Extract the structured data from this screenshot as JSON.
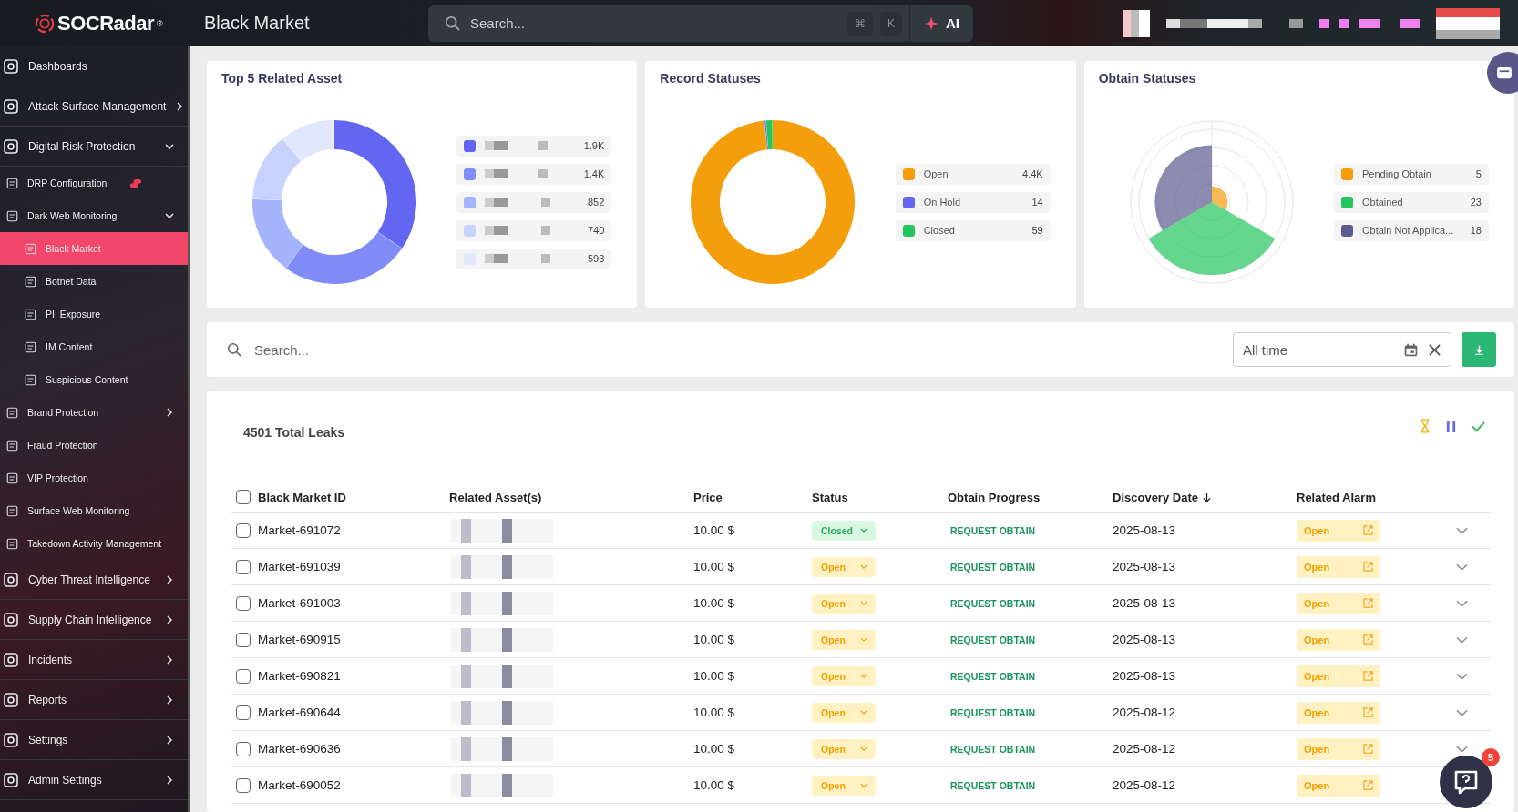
{
  "topbar": {
    "logo": "SOCRadar",
    "logo_mark": "®",
    "page_title": "Black Market",
    "search": {
      "placeholder": "Search..."
    },
    "shortcut_keys": [
      "⌘",
      "K"
    ],
    "ai_button": "AI"
  },
  "sidebar": {
    "items": [
      {
        "label": "Dashboards",
        "selected": false
      },
      {
        "label": "Attack Surface Management",
        "selected": false,
        "expanded": false
      },
      {
        "label": "Digital Risk Protection",
        "selected": false,
        "expanded": true,
        "children": [
          {
            "label": "DRP Configuration",
            "selected": false,
            "alert": true
          },
          {
            "label": "Dark Web Monitoring",
            "selected": false,
            "expanded": true,
            "children": [
              {
                "label": "Black Market",
                "selected": true
              },
              {
                "label": "Botnet Data",
                "selected": false
              },
              {
                "label": "PII Exposure",
                "selected": false
              },
              {
                "label": "IM Content",
                "selected": false
              },
              {
                "label": "Suspicious Content",
                "selected": false
              }
            ]
          },
          {
            "label": "Brand Protection",
            "selected": false,
            "expanded": false
          },
          {
            "label": "Fraud Protection",
            "selected": false
          },
          {
            "label": "VIP Protection",
            "selected": false
          },
          {
            "label": "Surface Web Monitoring",
            "selected": false
          },
          {
            "label": "Takedown Activity Management",
            "selected": false
          }
        ]
      },
      {
        "label": "Cyber Threat Intelligence",
        "selected": false,
        "expanded": false
      },
      {
        "label": "Supply Chain Intelligence",
        "selected": false,
        "expanded": false
      },
      {
        "label": "Incidents",
        "selected": false,
        "expanded": false
      },
      {
        "label": "Reports",
        "selected": false,
        "expanded": false
      },
      {
        "label": "Settings",
        "selected": false,
        "expanded": false
      },
      {
        "label": "Admin Settings",
        "selected": false,
        "expanded": false
      }
    ]
  },
  "cards": [
    {
      "title": "Top 5 Related Asset",
      "legend": [
        {
          "value": "1.9K",
          "color": "#6366f1"
        },
        {
          "value": "1.4K",
          "color": "#818cf8"
        },
        {
          "value": "852",
          "color": "#a5b4fc"
        },
        {
          "value": "740",
          "color": "#c7d2fe"
        },
        {
          "value": "593",
          "color": "#e0e7ff"
        }
      ],
      "chart_data": {
        "type": "donut",
        "values": [
          34.6,
          25.5,
          15.5,
          13.5,
          10.9
        ]
      }
    },
    {
      "title": "Record Statuses",
      "legend": [
        {
          "label": "Open",
          "value": "4.4K",
          "color": "#f59e0b"
        },
        {
          "label": "On Hold",
          "value": "14",
          "color": "#6366f1"
        },
        {
          "label": "Closed",
          "value": "59",
          "color": "#22c55e"
        }
      ],
      "chart_data": {
        "type": "donut",
        "values": [
          98.4,
          0.3,
          1.3
        ]
      }
    },
    {
      "title": "Obtain Statuses",
      "legend": [
        {
          "label": "Pending Obtain",
          "value": "5",
          "color": "#f59e0b"
        },
        {
          "label": "Obtained",
          "value": "23",
          "color": "#22c55e"
        },
        {
          "label": "Obtain Not Applica...",
          "value": "18",
          "color": "#5b5b8f"
        }
      ]
    }
  ],
  "filter": {
    "search": {
      "placeholder": "Search..."
    },
    "date": {
      "value": "All time"
    }
  },
  "table": {
    "total": "4501 Total Leaks",
    "columns": [
      "Black Market ID",
      "Related Asset(s)",
      "Price",
      "Status",
      "Obtain Progress",
      "Discovery Date",
      "Related Alarm"
    ],
    "header_checked": false,
    "rows": [
      {
        "id": "Market-691072",
        "price": "10.00 $",
        "status": {
          "label": "Closed",
          "kind": "closed"
        },
        "obtain": "REQUEST OBTAIN",
        "date": "2025-08-13",
        "alarm": "Open",
        "checked": false
      },
      {
        "id": "Market-691039",
        "price": "10.00 $",
        "status": {
          "label": "Open",
          "kind": "open"
        },
        "obtain": "REQUEST OBTAIN",
        "date": "2025-08-13",
        "alarm": "Open",
        "checked": false
      },
      {
        "id": "Market-691003",
        "price": "10.00 $",
        "status": {
          "label": "Open",
          "kind": "open"
        },
        "obtain": "REQUEST OBTAIN",
        "date": "2025-08-13",
        "alarm": "Open",
        "checked": false
      },
      {
        "id": "Market-690915",
        "price": "10.00 $",
        "status": {
          "label": "Open",
          "kind": "open"
        },
        "obtain": "REQUEST OBTAIN",
        "date": "2025-08-13",
        "alarm": "Open",
        "checked": false
      },
      {
        "id": "Market-690821",
        "price": "10.00 $",
        "status": {
          "label": "Open",
          "kind": "open"
        },
        "obtain": "REQUEST OBTAIN",
        "date": "2025-08-13",
        "alarm": "Open",
        "checked": false
      },
      {
        "id": "Market-690644",
        "price": "10.00 $",
        "status": {
          "label": "Open",
          "kind": "open"
        },
        "obtain": "REQUEST OBTAIN",
        "date": "2025-08-12",
        "alarm": "Open",
        "checked": false
      },
      {
        "id": "Market-690636",
        "price": "10.00 $",
        "status": {
          "label": "Open",
          "kind": "open"
        },
        "obtain": "REQUEST OBTAIN",
        "date": "2025-08-12",
        "alarm": "Open",
        "checked": false
      },
      {
        "id": "Market-690052",
        "price": "10.00 $",
        "status": {
          "label": "Open",
          "kind": "open"
        },
        "obtain": "REQUEST OBTAIN",
        "date": "2025-08-12",
        "alarm": "Open",
        "checked": false
      }
    ]
  },
  "help_badge": "5"
}
